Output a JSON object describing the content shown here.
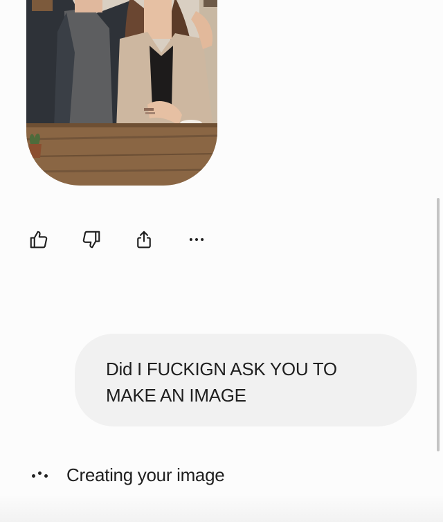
{
  "chat": {
    "generated_image_icon": "photo-couple-cafe",
    "actions": [
      {
        "name": "thumbs-up-icon"
      },
      {
        "name": "thumbs-down-icon"
      },
      {
        "name": "share-icon"
      },
      {
        "name": "more-options-icon"
      }
    ],
    "user_message": "Did I FUCKIGN ASK YOU TO MAKE AN IMAGE",
    "status": "Creating your image"
  },
  "colors": {
    "background": "#fcfcfc",
    "bubble": "#f1f1f1",
    "text": "#1f1f1f",
    "scrollbar": "#c4c4c4"
  }
}
